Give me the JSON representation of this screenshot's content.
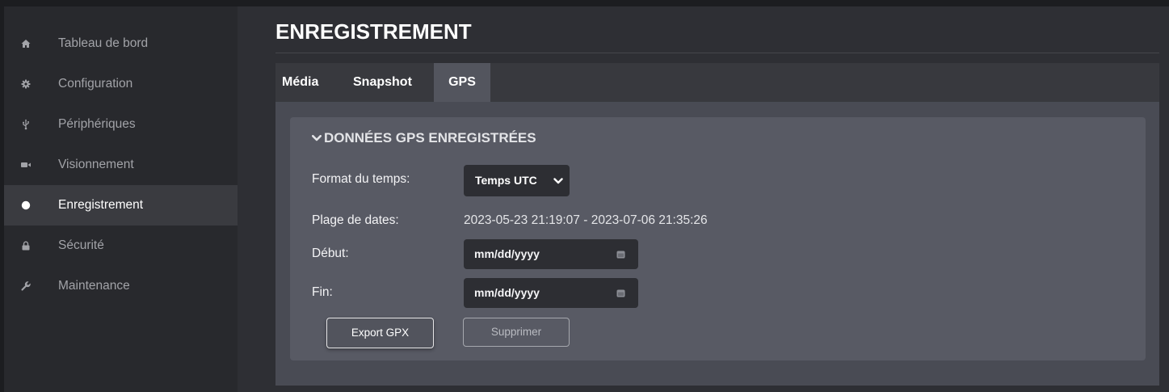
{
  "sidebar": {
    "items": [
      {
        "label": "Tableau de bord",
        "icon": "home-icon",
        "active": false
      },
      {
        "label": "Configuration",
        "icon": "gear-icon",
        "active": false
      },
      {
        "label": "Périphériques",
        "icon": "usb-icon",
        "active": false
      },
      {
        "label": "Visionnement",
        "icon": "video-camera-icon",
        "active": false
      },
      {
        "label": "Enregistrement",
        "icon": "record-icon",
        "active": true
      },
      {
        "label": "Sécurité",
        "icon": "lock-icon",
        "active": false
      },
      {
        "label": "Maintenance",
        "icon": "wrench-icon",
        "active": false
      }
    ]
  },
  "page": {
    "title": "ENREGISTREMENT"
  },
  "tabs": [
    {
      "label": "Média",
      "active": false
    },
    {
      "label": "Snapshot",
      "active": false
    },
    {
      "label": "GPS",
      "active": true
    }
  ],
  "gps_panel": {
    "header": "DONNÉES GPS ENREGISTRÉES",
    "header_icon": "chevron-down-icon",
    "expanded": true,
    "time_format": {
      "label": "Format du temps:",
      "selected": "Temps UTC",
      "icon": "chevron-down-icon"
    },
    "date_range": {
      "label": "Plage de dates:",
      "value": "2023-05-23 21:19:07 - 2023-07-06 21:35:26"
    },
    "start_date": {
      "label": "Début:",
      "placeholder": "mm/dd/yyyy",
      "icon": "calendar-icon"
    },
    "end_date": {
      "label": "Fin:",
      "placeholder": "mm/dd/yyyy",
      "icon": "calendar-icon"
    },
    "buttons": {
      "export": {
        "label": "Export GPX",
        "disabled": false
      },
      "delete": {
        "label": "Supprimer",
        "disabled": true
      }
    }
  }
}
